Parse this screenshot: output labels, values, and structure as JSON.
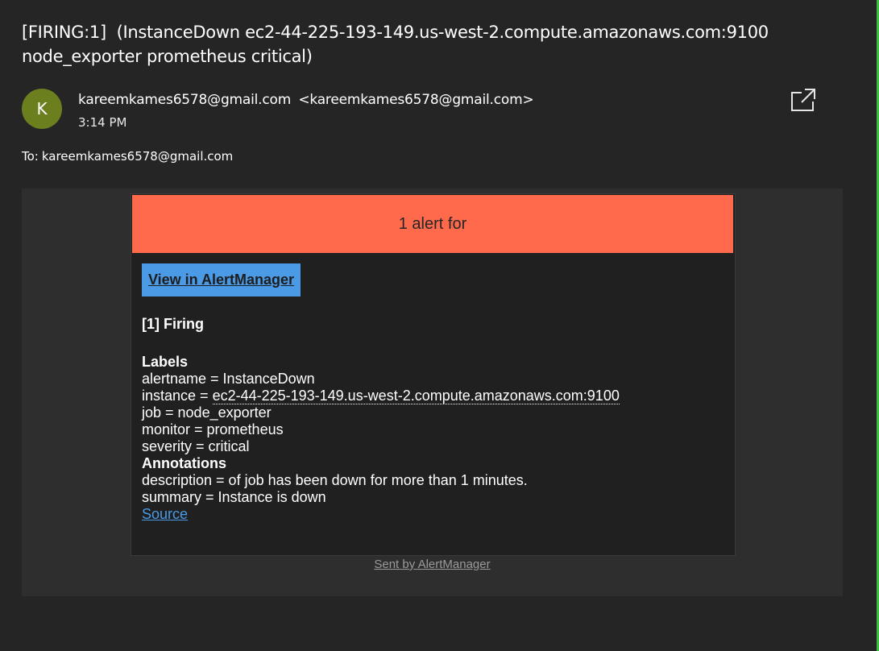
{
  "email": {
    "subject": "[FIRING:1]  (InstanceDown ec2-44-225-193-149.us-west-2.compute.amazonaws.com:9100 node_exporter prometheus critical)",
    "avatar_initial": "K",
    "avatar_color": "#6b7f1f",
    "sender_name": "kareemkames6578@gmail.com",
    "sender_address": "<kareemkames6578@gmail.com>",
    "time": "3:14 PM",
    "to_label": "To:",
    "to_address": "kareemkames6578@gmail.com",
    "popout_icon": "popout-window-icon"
  },
  "alert": {
    "header_text": "1 alert for",
    "header_color": "#ff6a4d",
    "button_label": "View in AlertManager",
    "button_color": "#4a9ae6",
    "firing_heading": "[1] Firing",
    "labels_heading": "Labels",
    "labels": {
      "alertname": "alertname = InstanceDown",
      "instance_prefix": "instance = ",
      "instance_value": "ec2-44-225-193-149.us-west-2.compute.amazonaws.com:9100",
      "job": "job = node_exporter",
      "monitor": "monitor = prometheus",
      "severity": "severity = critical"
    },
    "annotations_heading": "Annotations",
    "annotations": {
      "description": "description = of job has been down for more than 1 minutes.",
      "summary": "summary = Instance is down"
    },
    "source_label": "Source",
    "footer": "Sent by AlertManager"
  },
  "colors": {
    "background": "#252525",
    "body_frame": "#2e2e2e",
    "accent_right": "#3fbf3f",
    "link": "#4a9ae6"
  }
}
